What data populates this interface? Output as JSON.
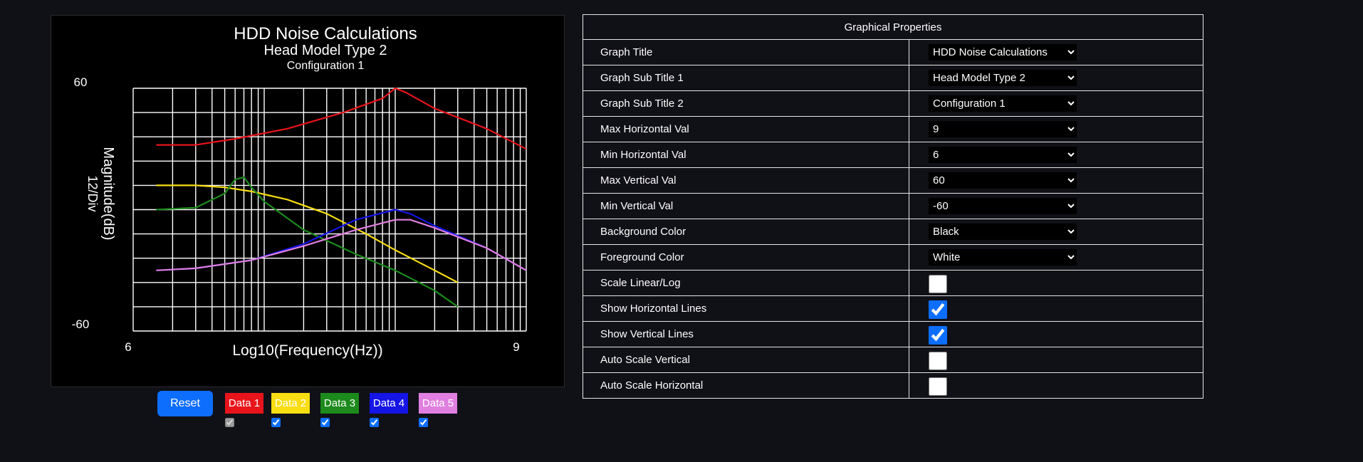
{
  "chart_data": {
    "type": "line",
    "title": "HDD Noise Calculations",
    "subtitle1": "Head Model Type 2",
    "subtitle2": "Configuration 1",
    "xlabel": "Log10(Frequency(Hz))",
    "ylabel": "Magnitude(dB)",
    "ydiv_label": "12/Div",
    "xscale": "log",
    "xlim": [
      1000000,
      1000000000
    ],
    "ylim": [
      -60,
      60
    ],
    "x_tick_labels": [
      "6",
      "9"
    ],
    "y_tick_labels": [
      "60",
      "-60"
    ],
    "grid": true,
    "background": "#000000",
    "foreground": "#ffffff",
    "series": [
      {
        "name": "Data 1",
        "color": "#e8141b",
        "x": [
          1500000,
          3000000,
          6000000,
          15000000,
          40000000,
          80000000,
          100000000,
          120000000,
          200000000,
          500000000,
          1000000000
        ],
        "y": [
          32,
          32,
          35,
          40,
          48,
          55,
          60,
          58,
          50,
          40,
          30
        ]
      },
      {
        "name": "Data 2",
        "color": "#f8dd12",
        "x": [
          1500000,
          3000000,
          5000000,
          8000000,
          15000000,
          30000000,
          60000000,
          100000000,
          200000000,
          300000000
        ],
        "y": [
          12,
          12,
          11,
          9,
          5,
          -2,
          -12,
          -20,
          -30,
          -36
        ]
      },
      {
        "name": "Data 3",
        "color": "#1c8a1c",
        "x": [
          1500000,
          3000000,
          5000000,
          6000000,
          7000000,
          8000000,
          10000000,
          20000000,
          50000000,
          100000000,
          200000000,
          300000000
        ],
        "y": [
          0,
          1,
          8,
          15,
          16,
          11,
          4,
          -10,
          -22,
          -30,
          -40,
          -48
        ]
      },
      {
        "name": "Data 4",
        "color": "#1515e6",
        "x": [
          1500000,
          3000000,
          8000000,
          20000000,
          50000000,
          100000000,
          130000000,
          200000000,
          500000000,
          1000000000
        ],
        "y": [
          -30,
          -29,
          -25,
          -17,
          -5,
          0,
          -2,
          -8,
          -19,
          -30
        ]
      },
      {
        "name": "Data 5",
        "color": "#e07fe0",
        "x": [
          1500000,
          3000000,
          8000000,
          20000000,
          50000000,
          100000000,
          130000000,
          200000000,
          500000000,
          1000000000
        ],
        "y": [
          -30,
          -29,
          -25,
          -18,
          -10,
          -5,
          -5,
          -9,
          -19,
          -30
        ]
      }
    ]
  },
  "controls": {
    "reset_label": "Reset",
    "series_toggles": [
      {
        "label": "Data 1",
        "bg": "#e8141b",
        "fg": "#ffffff",
        "checked": true,
        "disabled": true
      },
      {
        "label": "Data 2",
        "bg": "#f8dd12",
        "fg": "#ffffff",
        "checked": true,
        "disabled": false
      },
      {
        "label": "Data 3",
        "bg": "#1c8a1c",
        "fg": "#ffffff",
        "checked": true,
        "disabled": false
      },
      {
        "label": "Data 4",
        "bg": "#1515e6",
        "fg": "#ffffff",
        "checked": true,
        "disabled": false
      },
      {
        "label": "Data 5",
        "bg": "#e07fe0",
        "fg": "#ffffff",
        "checked": true,
        "disabled": false
      }
    ]
  },
  "properties": {
    "header": "Graphical Properties",
    "rows": [
      {
        "label": "Graph Title",
        "kind": "select",
        "value": "HDD Noise Calculations"
      },
      {
        "label": "Graph Sub Title 1",
        "kind": "select",
        "value": "Head Model Type 2"
      },
      {
        "label": "Graph Sub Title 2",
        "kind": "select",
        "value": "Configuration 1"
      },
      {
        "label": "Max Horizontal Val",
        "kind": "select",
        "value": "9"
      },
      {
        "label": "Min Horizontal Val",
        "kind": "select",
        "value": "6"
      },
      {
        "label": "Max Vertical Val",
        "kind": "select",
        "value": "60"
      },
      {
        "label": "Min Vertical Val",
        "kind": "select",
        "value": "-60"
      },
      {
        "label": "Background Color",
        "kind": "select",
        "value": "Black"
      },
      {
        "label": "Foreground Color",
        "kind": "select",
        "value": "White"
      },
      {
        "label": "Scale Linear/Log",
        "kind": "checkbox",
        "checked": false
      },
      {
        "label": "Show Horizontal Lines",
        "kind": "checkbox",
        "checked": true
      },
      {
        "label": "Show Vertical Lines",
        "kind": "checkbox",
        "checked": true
      },
      {
        "label": "Auto Scale Vertical",
        "kind": "checkbox",
        "checked": false
      },
      {
        "label": "Auto Scale Horizontal",
        "kind": "checkbox",
        "checked": false
      }
    ]
  }
}
